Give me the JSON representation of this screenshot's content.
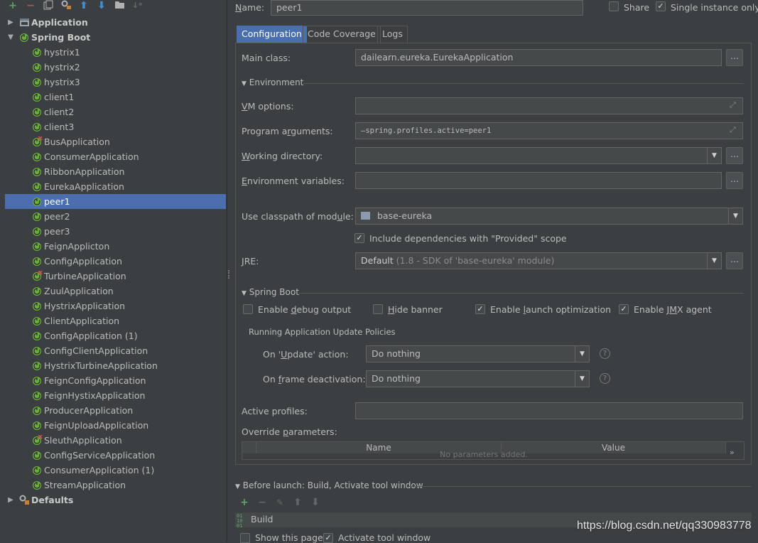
{
  "toolbar": {
    "icons": [
      "add-icon",
      "remove-icon",
      "copy-icon",
      "edit-defaults-icon",
      "move-up-icon",
      "move-down-icon",
      "folder-icon",
      "sort-icon"
    ]
  },
  "tree": {
    "application_label": "Application",
    "spring_boot_label": "Spring Boot",
    "defaults_label": "Defaults",
    "items": [
      {
        "label": "hystrix1",
        "error": false
      },
      {
        "label": "hystrix2",
        "error": false
      },
      {
        "label": "hystrix3",
        "error": false
      },
      {
        "label": "client1",
        "error": false
      },
      {
        "label": "client2",
        "error": false
      },
      {
        "label": "client3",
        "error": false
      },
      {
        "label": "BusApplication",
        "error": true
      },
      {
        "label": "ConsumerApplication",
        "error": false
      },
      {
        "label": "RibbonApplication",
        "error": false
      },
      {
        "label": "EurekaApplication",
        "error": false
      },
      {
        "label": "peer1",
        "error": false,
        "selected": true
      },
      {
        "label": "peer2",
        "error": false
      },
      {
        "label": "peer3",
        "error": false
      },
      {
        "label": "FeignApplicton",
        "error": false
      },
      {
        "label": "ConfigApplication",
        "error": false
      },
      {
        "label": "TurbineApplication",
        "error": true
      },
      {
        "label": "ZuulApplication",
        "error": false
      },
      {
        "label": "HystrixApplication",
        "error": false
      },
      {
        "label": "ClientApplication",
        "error": false
      },
      {
        "label": "ConfigApplication (1)",
        "error": false
      },
      {
        "label": "ConfigClientApplication",
        "error": false
      },
      {
        "label": "HystrixTurbineApplication",
        "error": false
      },
      {
        "label": "FeignConfigApplication",
        "error": false
      },
      {
        "label": "FeignHystixApplication",
        "error": false
      },
      {
        "label": "ProducerApplication",
        "error": false
      },
      {
        "label": "FeignUploadApplication",
        "error": false
      },
      {
        "label": "SleuthApplication",
        "error": true
      },
      {
        "label": "ConfigServiceApplication",
        "error": false
      },
      {
        "label": "ConsumerApplication (1)",
        "error": false
      },
      {
        "label": "StreamApplication",
        "error": false
      }
    ]
  },
  "header": {
    "name_label": "Name:",
    "name_value": "peer1",
    "share_label": "Share",
    "single_instance_label": "Single instance only"
  },
  "tabs": [
    "Configuration",
    "Code Coverage",
    "Logs"
  ],
  "config": {
    "main_class_label": "Main class:",
    "main_class_value": "dailearn.eureka.EurekaApplication",
    "environment_section": "Environment",
    "vm_options_label": "VM options:",
    "vm_options_value": "",
    "program_args_label": "Program arguments:",
    "program_args_value": "—spring.profiles.active=peer1",
    "working_dir_label": "Working directory:",
    "working_dir_value": "",
    "env_vars_label": "Environment variables:",
    "env_vars_value": "",
    "classpath_label": "Use classpath of module:",
    "classpath_value": "base-eureka",
    "include_deps_label": "Include dependencies with \"Provided\" scope",
    "jre_label": "JRE:",
    "jre_value": "Default",
    "jre_detail": "(1.8 - SDK of 'base-eureka' module)",
    "spring_boot_section": "Spring Boot",
    "debug_output_label": "Enable debug output",
    "hide_banner_label": "Hide banner",
    "launch_opt_label": "Enable launch optimization",
    "jmx_label": "Enable JMX agent",
    "policies_title": "Running Application Update Policies",
    "on_update_label": "On 'Update' action:",
    "on_update_value": "Do nothing",
    "on_frame_label": "On frame deactivation:",
    "on_frame_value": "Do nothing",
    "active_profiles_label": "Active profiles:",
    "active_profiles_value": "",
    "override_params_label": "Override parameters:",
    "table_headers": [
      "Name",
      "Value"
    ],
    "table_empty_text": "No parameters added."
  },
  "before_launch": {
    "title": "Before launch: Build, Activate tool window",
    "task": "Build",
    "show_page_label": "Show this page",
    "activate_label": "Activate tool window"
  },
  "watermark": "https://blog.csdn.net/qq330983778",
  "colors": {
    "background": "#3c3f41",
    "selection": "#4b6eaf",
    "spring_green": "#6aaf3e",
    "error_red": "#c75450"
  }
}
